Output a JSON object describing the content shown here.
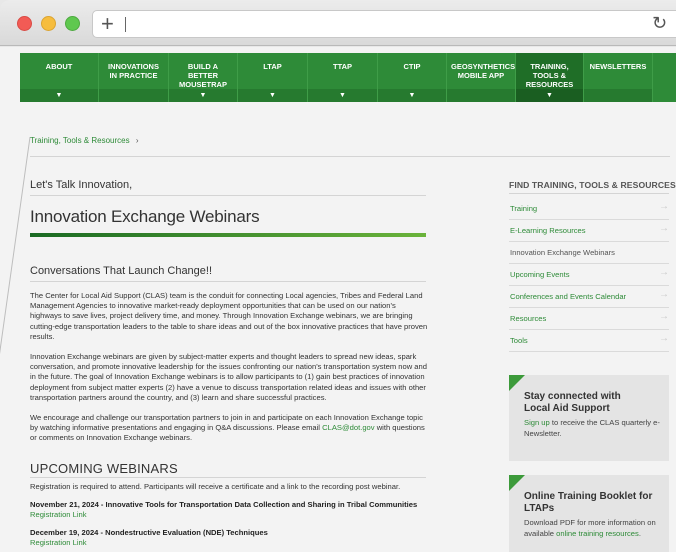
{
  "browser": {
    "new_tab_label": "+",
    "reload_icon": "reload-icon"
  },
  "nav": {
    "items": [
      {
        "label": "ABOUT"
      },
      {
        "label": "INNOVATIONS IN PRACTICE"
      },
      {
        "label": "BUILD A BETTER MOUSETRAP"
      },
      {
        "label": "LTAP"
      },
      {
        "label": "TTAP"
      },
      {
        "label": "CTIP"
      },
      {
        "label": "GEOSYNTHETICS MOBILE APP"
      },
      {
        "label": "TRAINING, TOOLS & RESOURCES"
      },
      {
        "label": "NEWSLETTERS"
      }
    ],
    "arrow": "▼",
    "active_color": "#1f6e27"
  },
  "breadcrumb": {
    "label": "Training, Tools & Resources",
    "sep": "›"
  },
  "main": {
    "intro": "Let's Talk Innovation,",
    "title": "Innovation Exchange Webinars",
    "subhead": "Conversations That Launch Change!!",
    "para1": "The Center for Local Aid Support (CLAS) team is the conduit for connecting Local agencies, Tribes and Federal Land Management Agencies to innovative market-ready deployment opportunities that can be used on our nation's highways to save lives, project delivery time, and money. Through Innovation Exchange webinars, we are bringing cutting-edge transportation leaders to the table to share ideas and out of the box innovative practices that have proven results.",
    "para2": "Innovation Exchange webinars are given by subject-matter experts and thought leaders to spread new ideas, spark conversation, and promote innovative leadership for the issues confronting our nation's transportation system now and in the future. The goal of Innovation Exchange webinars is to allow participants to (1) gain best practices of innovation deployment from subject matter experts (2) have a venue to discuss transportation related ideas and issues with other transportation partners around the country, and (3) learn and share successful practices.",
    "para3_before": "We encourage and challenge our transportation partners to join in and participate on each Innovation Exchange topic by watching informative presentations and engaging in Q&A discussions. Please email ",
    "para3_email": "CLAS@dot.gov",
    "para3_after": " with questions or comments on Innovation Exchange webinars.",
    "upcoming_title": "UPCOMING WEBINARS",
    "registration_note": "Registration is required to attend. Participants will receive a certificate and a link to the recording post webinar.",
    "events": [
      {
        "title": "November 21, 2024 - Innovative Tools for Transportation Data Collection and Sharing in Tribal Communities",
        "link": "Registration Link"
      },
      {
        "title": "December 19, 2024 - Nondestructive Evaluation (NDE) Techniques",
        "link": "Registration Link"
      }
    ]
  },
  "sidebar": {
    "heading": "FIND TRAINING, TOOLS & RESOURCES",
    "arrow": "→",
    "items": [
      {
        "label": "Training"
      },
      {
        "label": "E-Learning Resources"
      },
      {
        "label": "Innovation Exchange Webinars"
      },
      {
        "label": "Upcoming Events"
      },
      {
        "label": "Conferences and Events Calendar"
      },
      {
        "label": "Resources"
      },
      {
        "label": "Tools"
      }
    ],
    "card1": {
      "title": "Stay connected with Local Aid Support",
      "link": "Sign up",
      "text": " to receive the CLAS quarterly e-Newsletter."
    },
    "card2": {
      "title": "Online Training Booklet for LTAPs",
      "text_before": "Download PDF for more information on available ",
      "link": "online training resources",
      "text_after": "."
    }
  }
}
